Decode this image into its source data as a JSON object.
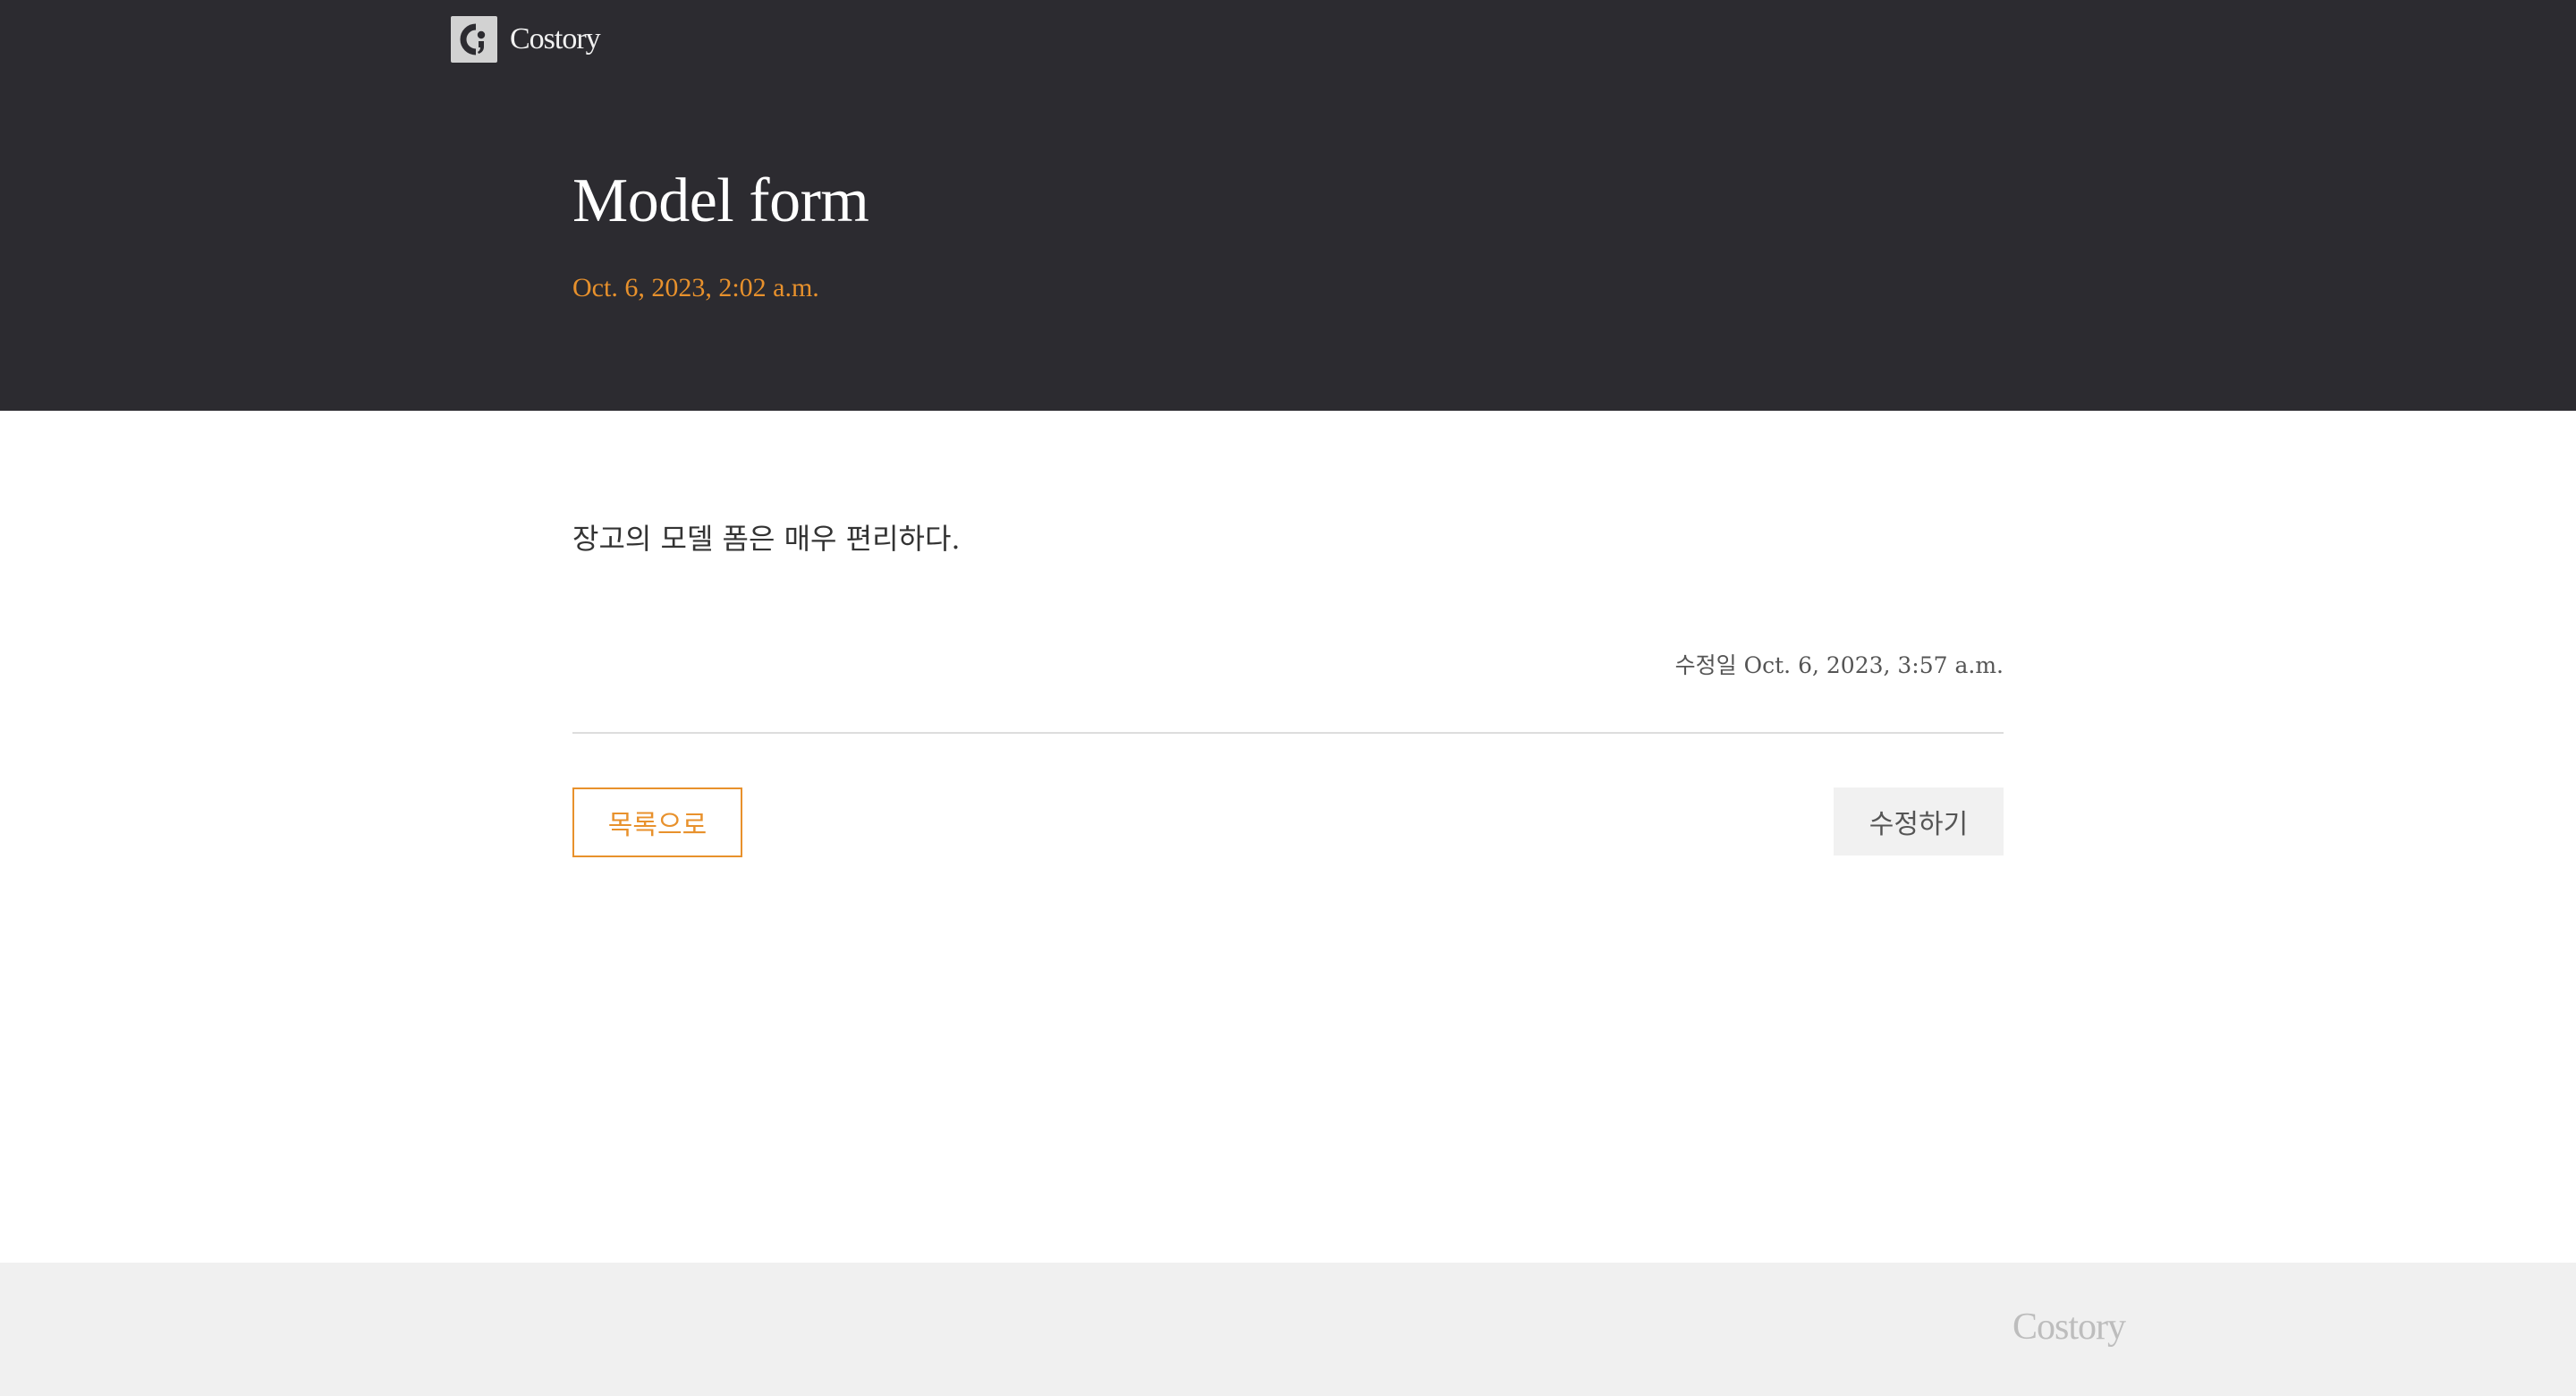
{
  "brand": {
    "name": "Costory",
    "logo_icon": "costory-c-logo-icon",
    "accent_color": "#e8912c",
    "header_bg": "#2c2b30",
    "footer_bg": "#f0f0f0"
  },
  "post": {
    "title": "Model form",
    "created": "Oct. 6, 2023, 2:02 a.m.",
    "body": "장고의 모델 폼은 매우 편리하다.",
    "modified_label": "수정일",
    "modified": "Oct. 6, 2023, 3:57 a.m."
  },
  "actions": {
    "list_label": "목록으로",
    "edit_label": "수정하기"
  },
  "footer": {
    "brand": "Costory"
  }
}
